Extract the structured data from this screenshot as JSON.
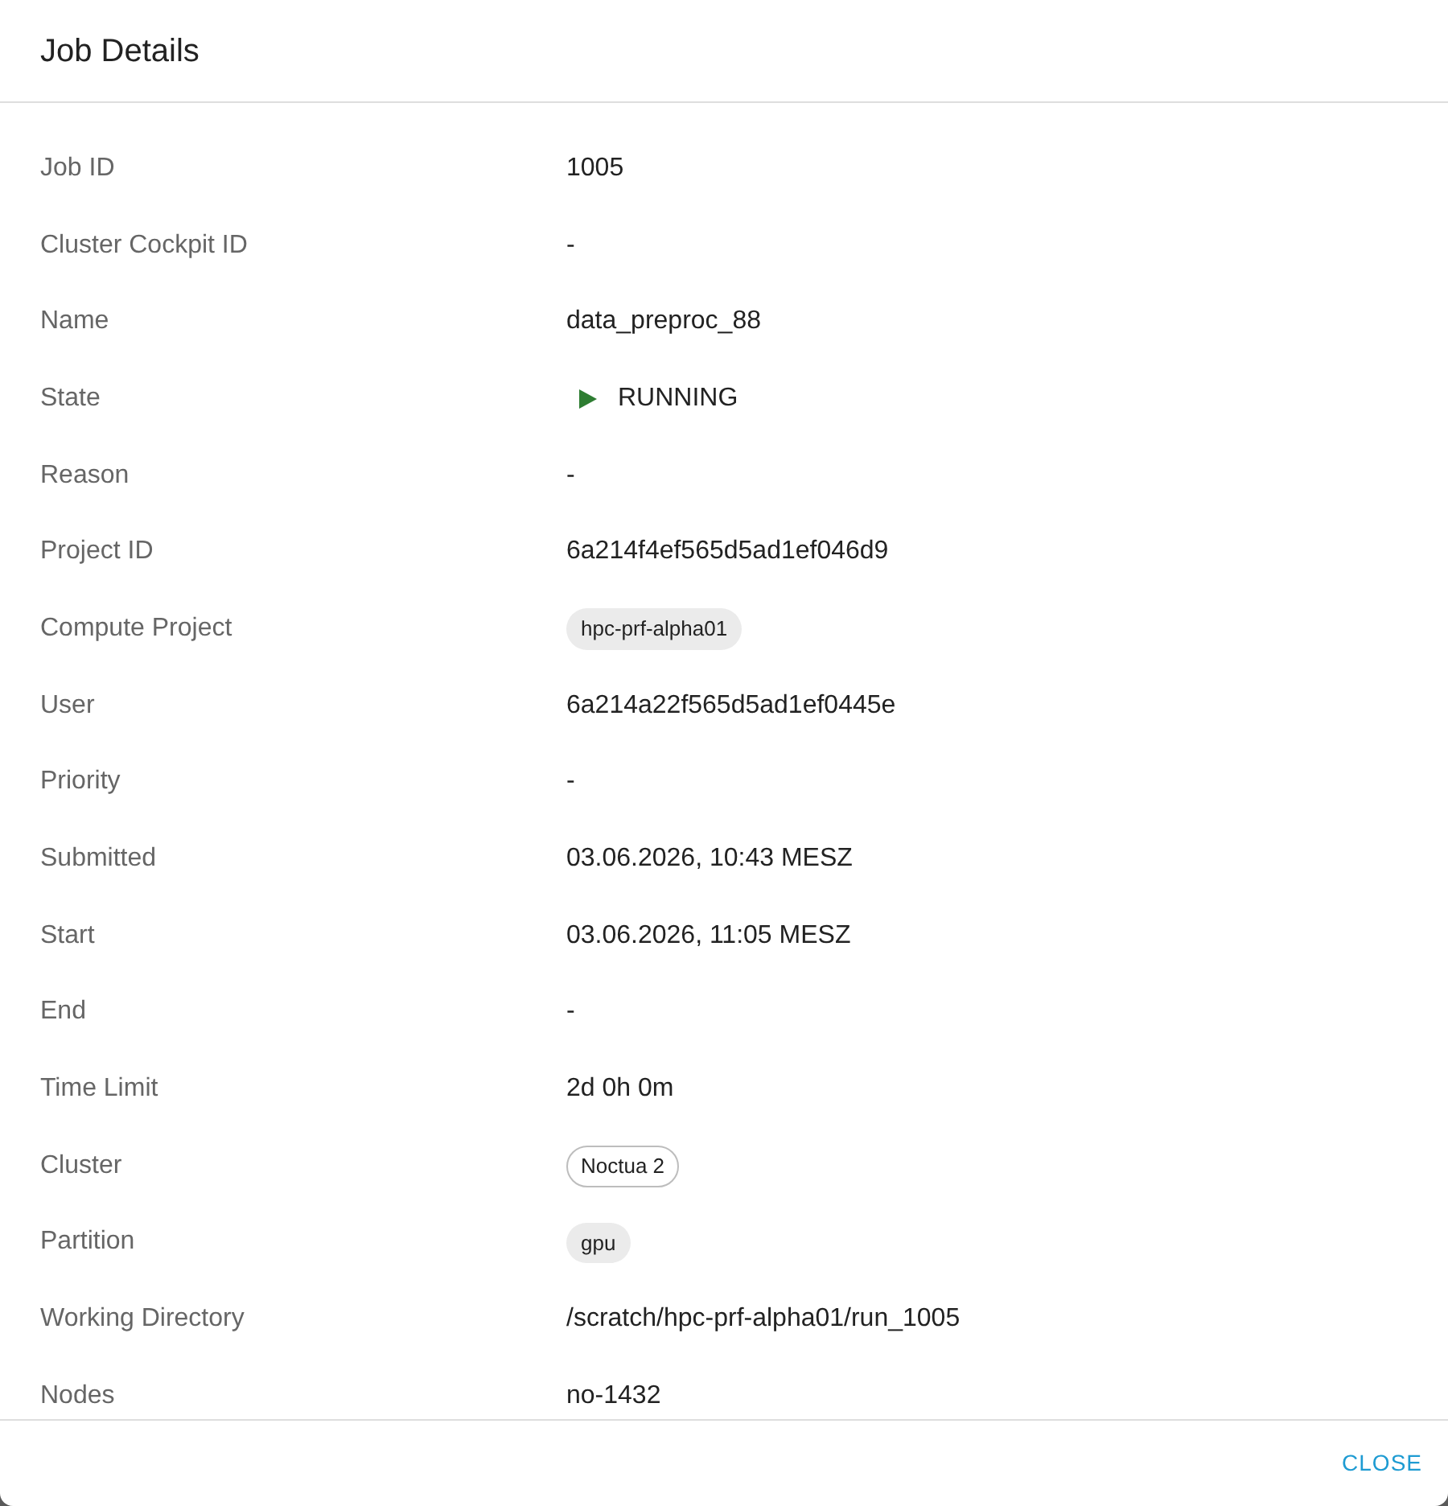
{
  "dialog": {
    "title": "Job Details"
  },
  "fields": [
    {
      "label": "Job ID",
      "kind": "text",
      "value": "1005"
    },
    {
      "label": "Cluster Cockpit ID",
      "kind": "text",
      "value": "-"
    },
    {
      "label": "Name",
      "kind": "text",
      "value": "data_preproc_88"
    },
    {
      "label": "State",
      "kind": "status",
      "value": "RUNNING"
    },
    {
      "label": "Reason",
      "kind": "text",
      "value": "-"
    },
    {
      "label": "Project ID",
      "kind": "text",
      "value": "6a214f4ef565d5ad1ef046d9"
    },
    {
      "label": "Compute Project",
      "kind": "chip",
      "value": "hpc-prf-alpha01"
    },
    {
      "label": "User",
      "kind": "text",
      "value": "6a214a22f565d5ad1ef0445e"
    },
    {
      "label": "Priority",
      "kind": "text",
      "value": "-"
    },
    {
      "label": "Submitted",
      "kind": "text",
      "value": "03.06.2026, 10:43 MESZ"
    },
    {
      "label": "Start",
      "kind": "text",
      "value": "03.06.2026, 11:05 MESZ"
    },
    {
      "label": "End",
      "kind": "text",
      "value": "-"
    },
    {
      "label": "Time Limit",
      "kind": "text",
      "value": "2d 0h 0m"
    },
    {
      "label": "Cluster",
      "kind": "outlined_chip",
      "value": "Noctua 2"
    },
    {
      "label": "Partition",
      "kind": "chip",
      "value": "gpu"
    },
    {
      "label": "Working Directory",
      "kind": "text",
      "value": "/scratch/hpc-prf-alpha01/run_1005"
    },
    {
      "label": "Nodes",
      "kind": "text",
      "value": "no-1432"
    }
  ],
  "footer": {
    "buttons": [
      "CLOSE"
    ]
  }
}
